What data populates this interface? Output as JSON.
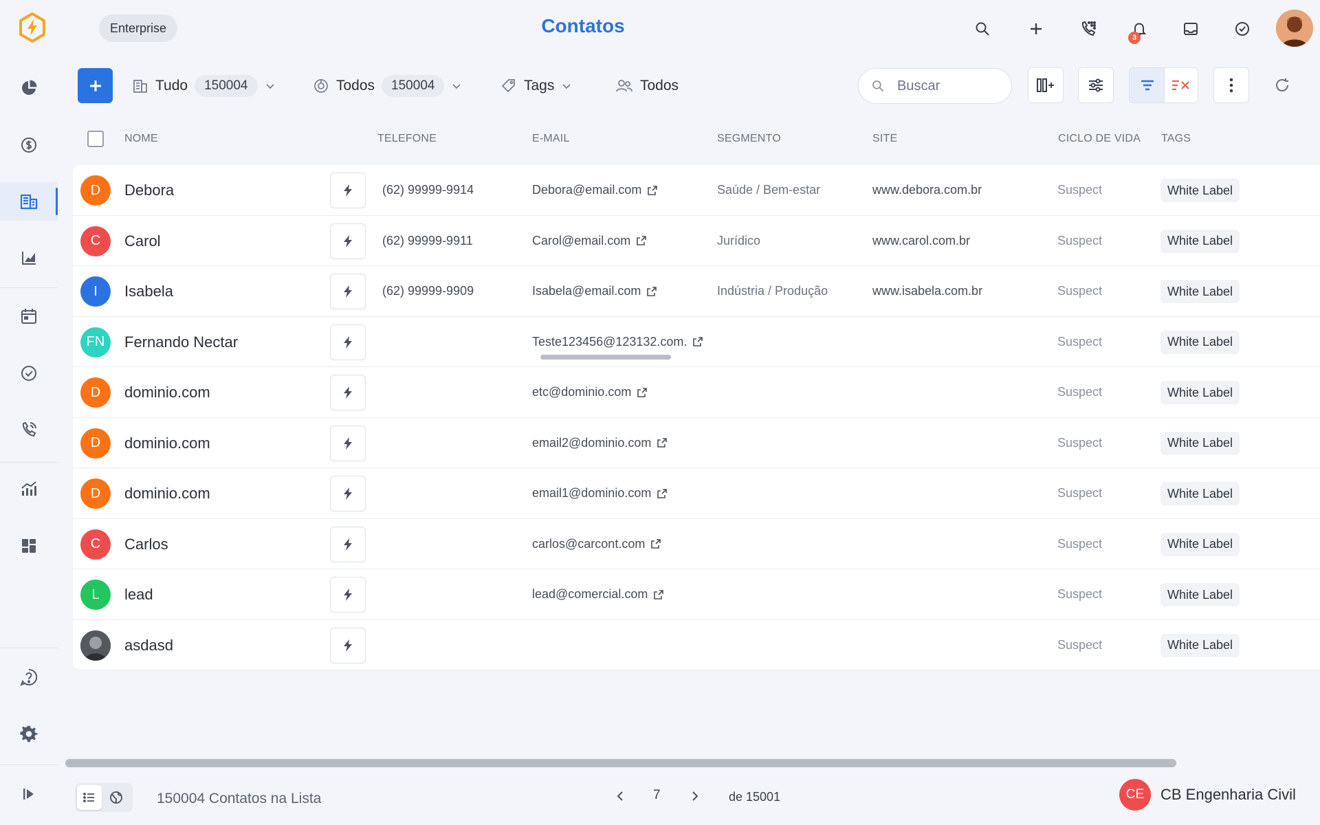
{
  "sidebar": {
    "items": [
      {
        "icon": "pie-chart-icon"
      },
      {
        "icon": "dollar-icon"
      },
      {
        "icon": "building-icon",
        "active": true
      },
      {
        "icon": "bar-chart-icon"
      },
      {
        "icon": "calendar-icon"
      },
      {
        "icon": "check-circle-icon"
      },
      {
        "icon": "phone-call-icon"
      },
      {
        "icon": "analytics-icon"
      },
      {
        "icon": "dashboard-icon"
      }
    ],
    "bottom": [
      {
        "icon": "help-icon"
      },
      {
        "icon": "gear-icon"
      },
      {
        "icon": "expand-sidebar-icon"
      }
    ]
  },
  "header": {
    "plan_badge": "Enterprise",
    "title": "Contatos",
    "notification_count": "3",
    "accent": "#2b73e0"
  },
  "toolbar": {
    "filter_all": {
      "label": "Tudo",
      "count": "150004"
    },
    "filter_people": {
      "label": "Todos",
      "count": "150004"
    },
    "filter_tags": {
      "label": "Tags"
    },
    "filter_owners": {
      "label": "Todos"
    },
    "search_placeholder": "Buscar"
  },
  "table": {
    "columns": [
      "NOME",
      "TELEFONE",
      "E-MAIL",
      "SEGMENTO",
      "SITE",
      "CICLO DE VIDA",
      "TAGS"
    ],
    "rows": [
      {
        "initials": "D",
        "color": "#f97316",
        "name": "Debora",
        "phone": "(62) 99999-9914",
        "email": "Debora@email.com",
        "segment": "Saúde / Bem-estar",
        "site": "www.debora.com.br",
        "lifecycle": "Suspect",
        "tag": "White Label"
      },
      {
        "initials": "C",
        "color": "#ef4d4d",
        "name": "Carol",
        "phone": "(62) 99999-9911",
        "email": "Carol@email.com",
        "segment": "Jurídico",
        "site": "www.carol.com.br",
        "lifecycle": "Suspect",
        "tag": "White Label"
      },
      {
        "initials": "I",
        "color": "#2b73e0",
        "name": "Isabela",
        "phone": "(62) 99999-9909",
        "email": "Isabela@email.com",
        "segment": "Indústria / Produção",
        "site": "www.isabela.com.br",
        "lifecycle": "Suspect",
        "tag": "White Label"
      },
      {
        "initials": "FN",
        "color": "#2dd4bf",
        "name": "Fernando Nectar",
        "phone": "",
        "email": "Teste123456@123132.com.",
        "segment": "",
        "site": "",
        "lifecycle": "Suspect",
        "tag": "White Label"
      },
      {
        "initials": "D",
        "color": "#f97316",
        "name": "dominio.com",
        "phone": "",
        "email": "etc@dominio.com",
        "segment": "",
        "site": "",
        "lifecycle": "Suspect",
        "tag": "White Label"
      },
      {
        "initials": "D",
        "color": "#f97316",
        "name": "dominio.com",
        "phone": "",
        "email": "email2@dominio.com",
        "segment": "",
        "site": "",
        "lifecycle": "Suspect",
        "tag": "White Label"
      },
      {
        "initials": "D",
        "color": "#f97316",
        "name": "dominio.com",
        "phone": "",
        "email": "email1@dominio.com",
        "segment": "",
        "site": "",
        "lifecycle": "Suspect",
        "tag": "White Label"
      },
      {
        "initials": "C",
        "color": "#ef4d4d",
        "name": "Carlos",
        "phone": "",
        "email": "carlos@carcont.com",
        "segment": "",
        "site": "",
        "lifecycle": "Suspect",
        "tag": "White Label"
      },
      {
        "initials": "L",
        "color": "#22c55e",
        "name": "lead",
        "phone": "",
        "email": "lead@comercial.com",
        "segment": "",
        "site": "",
        "lifecycle": "Suspect",
        "tag": "White Label"
      },
      {
        "initials": "",
        "color": "#3b3f46",
        "photo": true,
        "name": "asdasd",
        "phone": "",
        "email": "",
        "segment": "",
        "site": "",
        "lifecycle": "Suspect",
        "tag": "White Label"
      }
    ]
  },
  "footer": {
    "count_label": "150004 Contatos na Lista",
    "current_page": "7",
    "total_pages": "de 15001",
    "company_initials": "CE",
    "company_name": "CB Engenharia Civil"
  }
}
